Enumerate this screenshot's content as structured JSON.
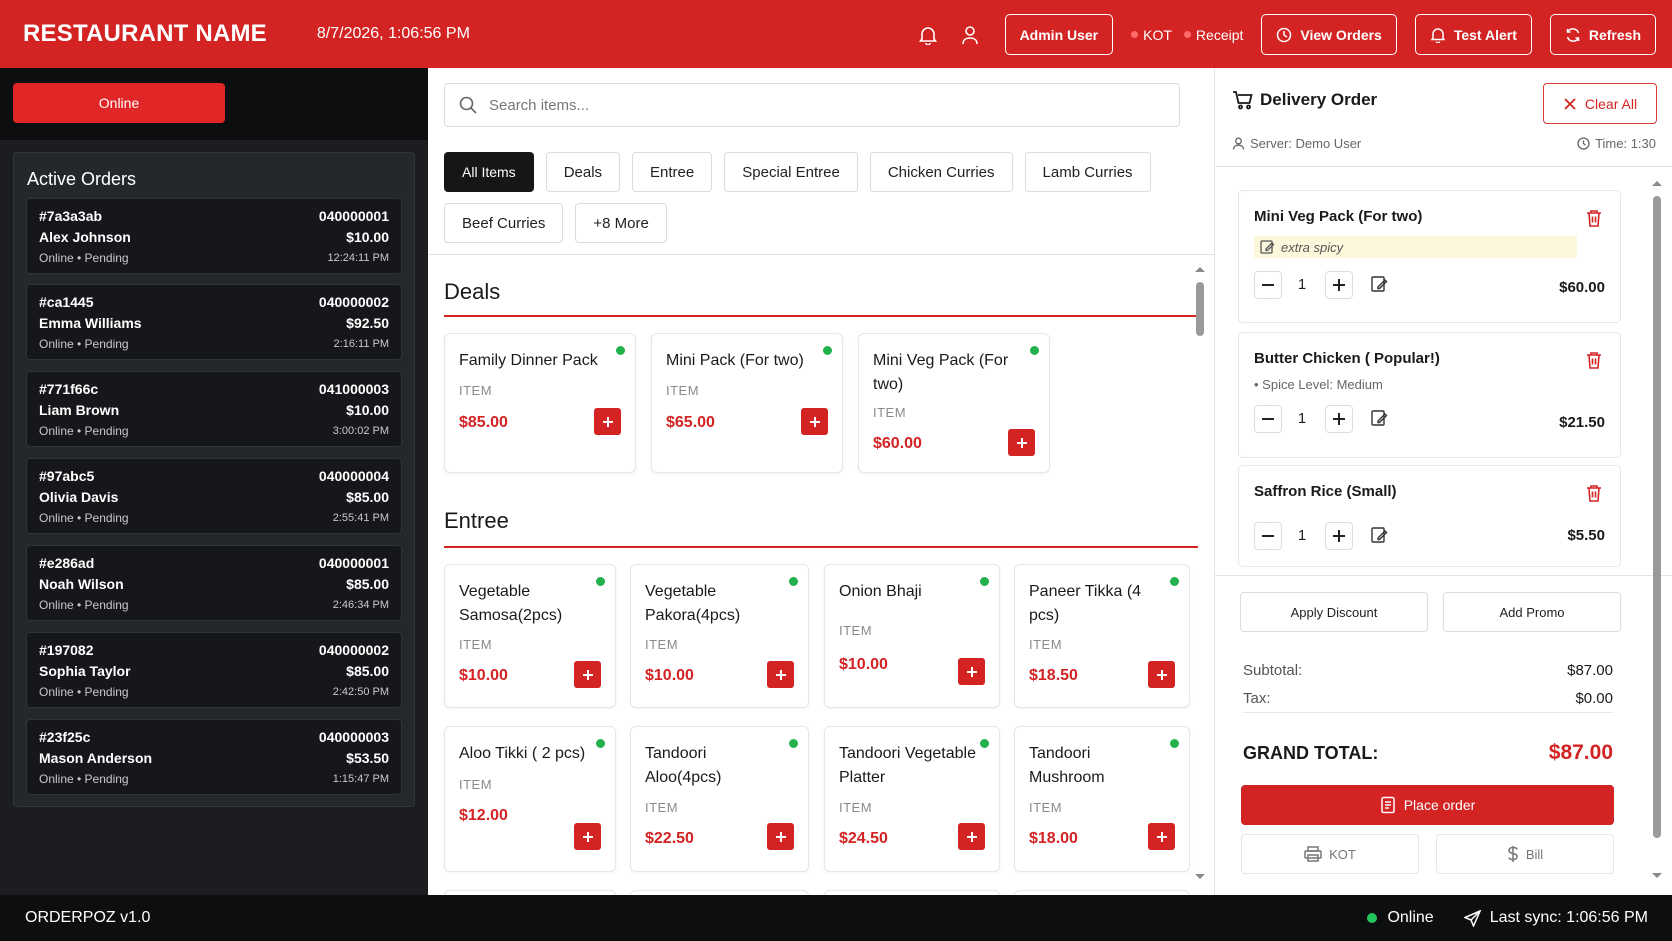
{
  "header": {
    "brand": "RESTAURANT NAME",
    "datetime": "8/7/2026, 1:06:56 PM",
    "admin_label": "Admin User",
    "kot_label": "KOT",
    "receipt_label": "Receipt",
    "view_orders_label": "View Orders",
    "test_alert_label": "Test Alert",
    "refresh_label": "Refresh"
  },
  "left": {
    "online_label": "Online",
    "active_orders_title": "Active Orders",
    "orders": [
      {
        "id": "#7a3a3ab",
        "name": "Alex Johnson",
        "status": "Online • Pending",
        "code": "040000001",
        "amount": "$10.00",
        "time": "12:24:11 PM"
      },
      {
        "id": "#ca1445",
        "name": "Emma Williams",
        "status": "Online • Pending",
        "code": "040000002",
        "amount": "$92.50",
        "time": "2:16:11 PM"
      },
      {
        "id": "#771f66c",
        "name": "Liam Brown",
        "status": "Online • Pending",
        "code": "041000003",
        "amount": "$10.00",
        "time": "3:00:02 PM"
      },
      {
        "id": "#97abc5",
        "name": "Olivia Davis",
        "status": "Online • Pending",
        "code": "040000004",
        "amount": "$85.00",
        "time": "2:55:41 PM"
      },
      {
        "id": "#e286ad",
        "name": "Noah Wilson",
        "status": "Online • Pending",
        "code": "040000001",
        "amount": "$85.00",
        "time": "2:46:34 PM"
      },
      {
        "id": "#197082",
        "name": "Sophia Taylor",
        "status": "Online • Pending",
        "code": "040000002",
        "amount": "$85.00",
        "time": "2:42:50 PM"
      },
      {
        "id": "#23f25c",
        "name": "Mason Anderson",
        "status": "Online • Pending",
        "code": "040000003",
        "amount": "$53.50",
        "time": "1:15:47 PM"
      }
    ]
  },
  "middle": {
    "search_placeholder": "Search items...",
    "categories": [
      "All Items",
      "Deals",
      "Entree",
      "Special Entree",
      "Chicken Curries",
      "Lamb Curries",
      "Beef Curries",
      "+8 More"
    ],
    "sections": [
      {
        "title": "Deals",
        "items": [
          {
            "name": "Family Dinner Pack",
            "type": "ITEM",
            "price": "$85.00"
          },
          {
            "name": "Mini Pack (For two)",
            "type": "ITEM",
            "price": "$65.00"
          },
          {
            "name": "Mini Veg Pack (For two)",
            "type": "ITEM",
            "price": "$60.00"
          }
        ]
      },
      {
        "title": "Entree",
        "items": [
          {
            "name": "Vegetable Samosa(2pcs)",
            "type": "ITEM",
            "price": "$10.00"
          },
          {
            "name": "Vegetable Pakora(4pcs)",
            "type": "ITEM",
            "price": "$10.00"
          },
          {
            "name": "Onion Bhaji",
            "type": "ITEM",
            "price": "$10.00"
          },
          {
            "name": "Paneer Tikka (4 pcs)",
            "type": "ITEM",
            "price": "$18.50"
          },
          {
            "name": "Aloo Tikki ( 2 pcs)",
            "type": "ITEM",
            "price": "$12.00"
          },
          {
            "name": "Tandoori Aloo(4pcs)",
            "type": "ITEM",
            "price": "$22.50"
          },
          {
            "name": "Tandoori Vegetable Platter",
            "type": "ITEM",
            "price": "$24.50"
          },
          {
            "name": "Tandoori Mushroom",
            "type": "ITEM",
            "price": "$18.00"
          }
        ]
      }
    ]
  },
  "right": {
    "title": "Delivery Order",
    "clear_label": "Clear All",
    "server": "Server: Demo User",
    "time": "Time: 1:30",
    "cart": [
      {
        "name": "Mini Veg Pack (For two)",
        "note": "extra spicy",
        "modifier": "",
        "qty": "1",
        "price": "$60.00"
      },
      {
        "name": "Butter Chicken ( Popular!)",
        "note": "",
        "modifier": "• Spice Level: Medium",
        "qty": "1",
        "price": "$21.50"
      },
      {
        "name": "Saffron Rice (Small)",
        "note": "",
        "modifier": "",
        "qty": "1",
        "price": "$5.50"
      }
    ],
    "apply_discount": "Apply Discount",
    "add_promo": "Add Promo",
    "subtotal_label": "Subtotal:",
    "subtotal": "$87.00",
    "tax_label": "Tax:",
    "tax": "$0.00",
    "grand_total_label": "GRAND TOTAL:",
    "grand_total": "$87.00",
    "place_order": "Place order",
    "kot": "KOT",
    "bill": "Bill"
  },
  "footer": {
    "app_name": "ORDERPOZ v1.0",
    "status": "Online",
    "last_sync": "Last sync: 1:06:56 PM"
  },
  "colors": {
    "brand_red": "#d32323",
    "dark_bg": "#1b1d21",
    "online_green": "#22b14c"
  }
}
